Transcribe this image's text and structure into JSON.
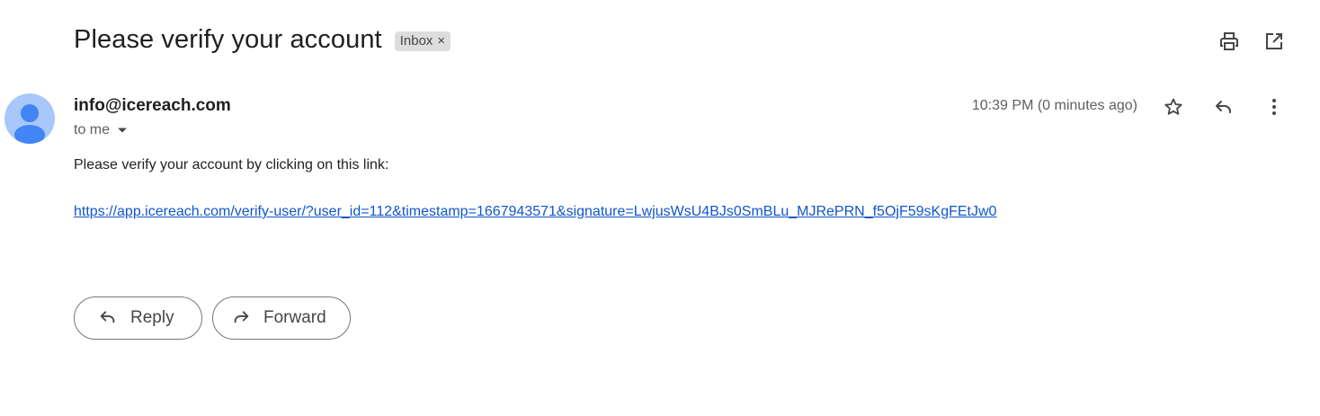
{
  "email": {
    "subject": "Please verify your account",
    "label": "Inbox",
    "label_remove": "×",
    "sender": "info@icereach.com",
    "recipient": "to me",
    "timestamp": "10:39 PM (0 minutes ago)",
    "body_text": "Please verify your account by clicking on this link:",
    "link": "https://app.icereach.com/verify-user/?user_id=112&timestamp=1667943571&signature=LwjusWsU4BJs0SmBLu_MJRePRN_f5OjF59sKgFEtJw0"
  },
  "actions": {
    "reply_label": "Reply",
    "forward_label": "Forward"
  },
  "icons": {
    "print": "print-icon",
    "open_new_window": "open-in-new-window-icon",
    "star": "star-icon",
    "reply": "reply-icon",
    "more": "more-vertical-icon",
    "dropdown": "caret-down-icon",
    "forward": "forward-icon"
  },
  "colors": {
    "avatar_bg": "#a8c7fa",
    "avatar_fg": "#4285f4",
    "link": "#1155cc",
    "chip_bg": "#dddddd"
  }
}
